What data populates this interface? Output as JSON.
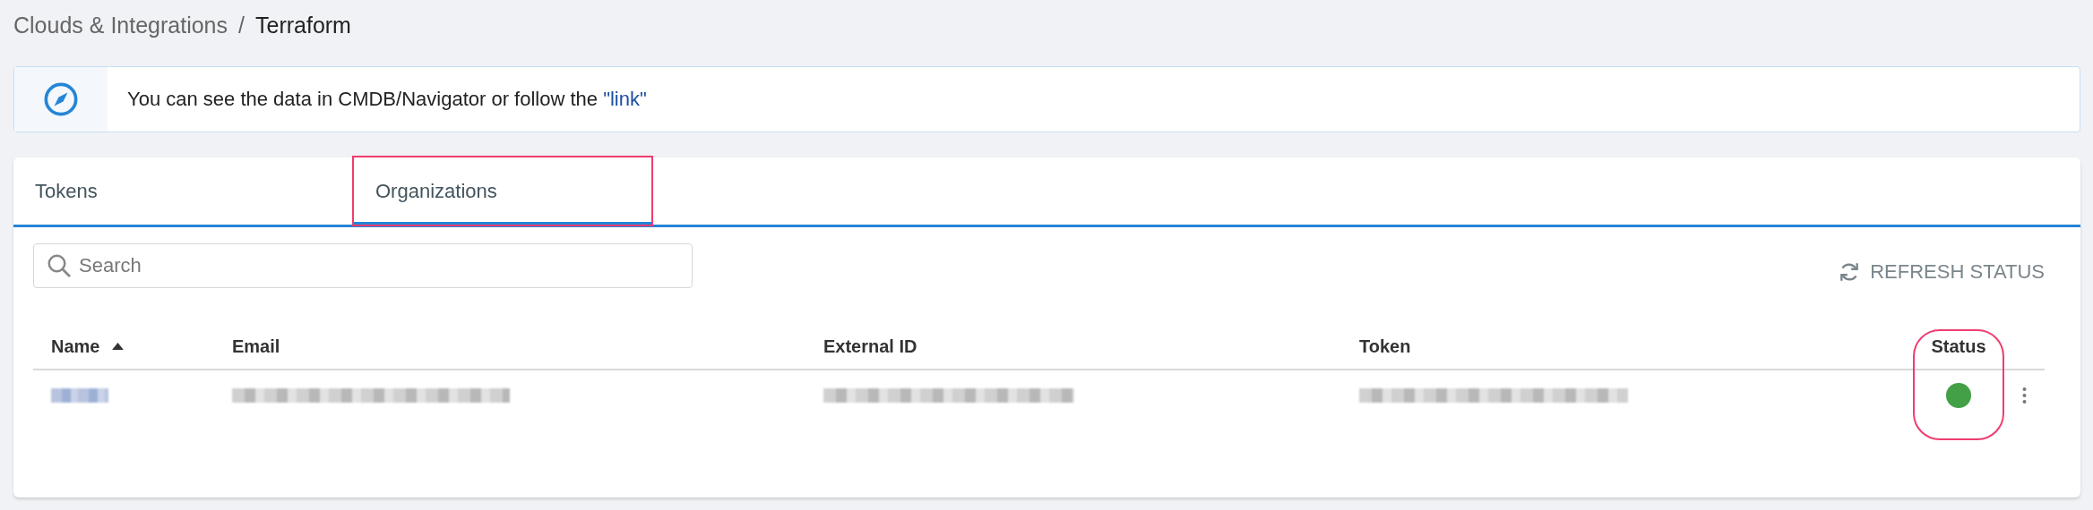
{
  "breadcrumb": {
    "separator": "/",
    "items": [
      {
        "label": "Clouds & Integrations",
        "current": false
      },
      {
        "label": "Terraform",
        "current": true
      }
    ]
  },
  "banner": {
    "text": "You can see the data in CMDB/Navigator or follow the ",
    "link": "\"link\""
  },
  "tabs": [
    {
      "label": "Tokens",
      "selected": false,
      "highlighted": false
    },
    {
      "label": "Organizations",
      "selected": true,
      "highlighted": true
    }
  ],
  "search": {
    "placeholder": "Search"
  },
  "refresh_button": "REFRESH STATUS",
  "table": {
    "columns": [
      {
        "label": "Name",
        "sort_ascending": true,
        "highlighted": false
      },
      {
        "label": "Email",
        "sort_ascending": false,
        "highlighted": false
      },
      {
        "label": "External ID",
        "sort_ascending": false,
        "highlighted": false
      },
      {
        "label": "Token",
        "sort_ascending": false,
        "highlighted": false
      },
      {
        "label": "Status",
        "sort_ascending": false,
        "highlighted": true
      }
    ],
    "rows": [
      {
        "cells": [
          {
            "kind": "redacted"
          },
          {
            "kind": "redacted"
          },
          {
            "kind": "redacted"
          },
          {
            "kind": "redacted"
          },
          {
            "kind": "status",
            "color": "#43a047"
          }
        ]
      }
    ]
  }
}
